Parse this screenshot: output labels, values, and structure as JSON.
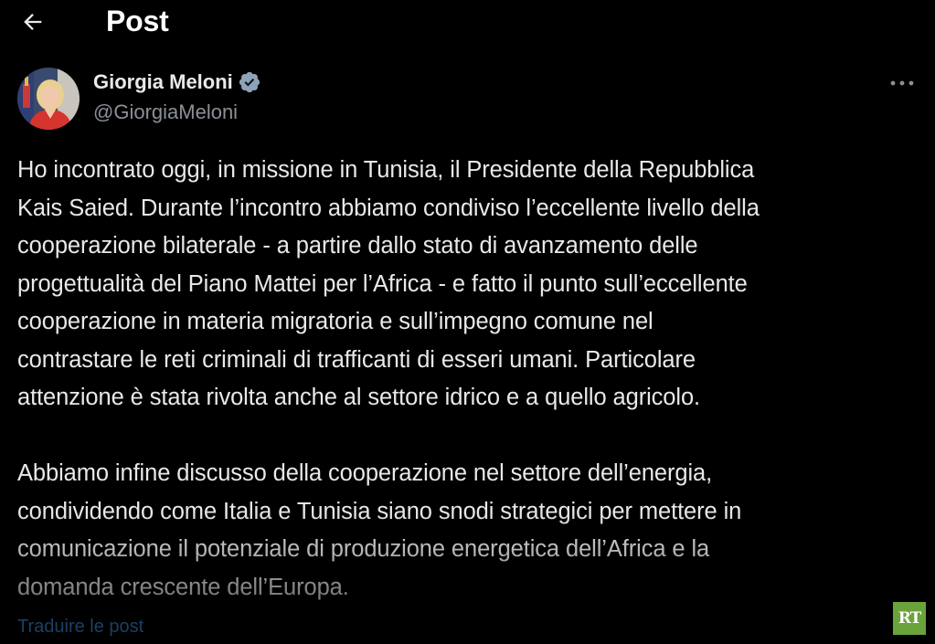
{
  "header": {
    "title": "Post",
    "back_icon": "arrow-left-icon"
  },
  "author": {
    "display_name": "Giorgia Meloni",
    "handle": "@GiorgiaMeloni",
    "verified_icon": "verified-badge-icon",
    "verified_color": "#1d9bf0"
  },
  "more_icon": "more-horizontal-icon",
  "post": {
    "lines_p1": [
      "Ho incontrato oggi, in missione in Tunisia, il Presidente della Repubblica",
      "Kais Saied. Durante l’incontro abbiamo condiviso l’eccellente livello della",
      "cooperazione bilaterale - a partire dallo stato di avanzamento delle",
      "progettualità del Piano Mattei per l’Africa - e fatto il punto sull’eccellente",
      "cooperazione in materia migratoria e sull’impegno comune nel",
      "contrastare le reti criminali di trafficanti di esseri umani. Particolare",
      "attenzione è stata rivolta anche al settore idrico e a quello agricolo."
    ],
    "lines_p2": [
      "Abbiamo infine discusso della cooperazione nel settore dell’energia,",
      "condividendo come Italia e Tunisia siano snodi strategici per mettere in",
      "comunicazione il potenziale di produzione energetica dell’Africa e la",
      "domanda crescente dell’Europa."
    ]
  },
  "translate_label": "Traduire le post",
  "watermark": {
    "text": "RT",
    "color": "#6aa33a"
  }
}
